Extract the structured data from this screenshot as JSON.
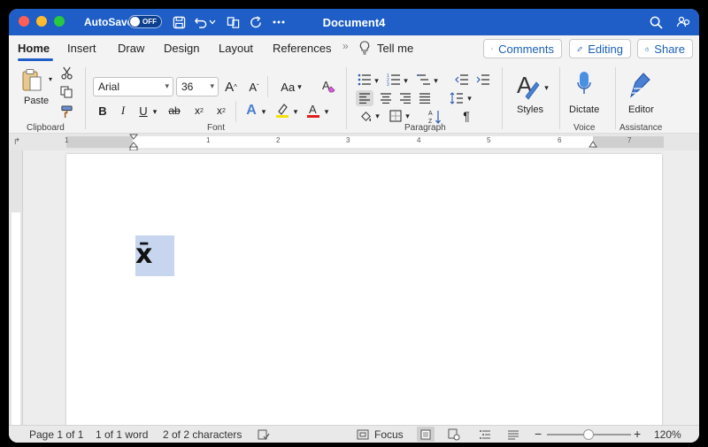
{
  "titlebar": {
    "autosave_label": "AutoSave",
    "autosave_state": "OFF",
    "document_title": "Document4",
    "color": "#1e5ec6"
  },
  "tabs": [
    {
      "label": "Home",
      "active": true
    },
    {
      "label": "Insert"
    },
    {
      "label": "Draw"
    },
    {
      "label": "Design"
    },
    {
      "label": "Layout"
    },
    {
      "label": "References"
    }
  ],
  "tell_me": "Tell me",
  "actions": {
    "comments": "Comments",
    "editing": "Editing",
    "share": "Share"
  },
  "ribbon": {
    "clipboard": {
      "paste": "Paste",
      "group": "Clipboard"
    },
    "font": {
      "name": "Arial",
      "size": "36",
      "group": "Font",
      "change_case": "Aa"
    },
    "paragraph": {
      "group": "Paragraph"
    },
    "styles": {
      "label": "Styles"
    },
    "voice": {
      "dictate": "Dictate",
      "group": "Voice"
    },
    "assistance": {
      "editor": "Editor",
      "group": "Assistance"
    }
  },
  "ruler": {
    "numbers": [
      "1",
      "1",
      "2",
      "3",
      "4",
      "5",
      "6",
      "7"
    ]
  },
  "document": {
    "content": "x̄"
  },
  "status": {
    "page": "Page 1 of 1",
    "words": "1 of 1 word",
    "characters": "2 of 2 characters",
    "focus": "Focus",
    "zoom": "120%"
  }
}
